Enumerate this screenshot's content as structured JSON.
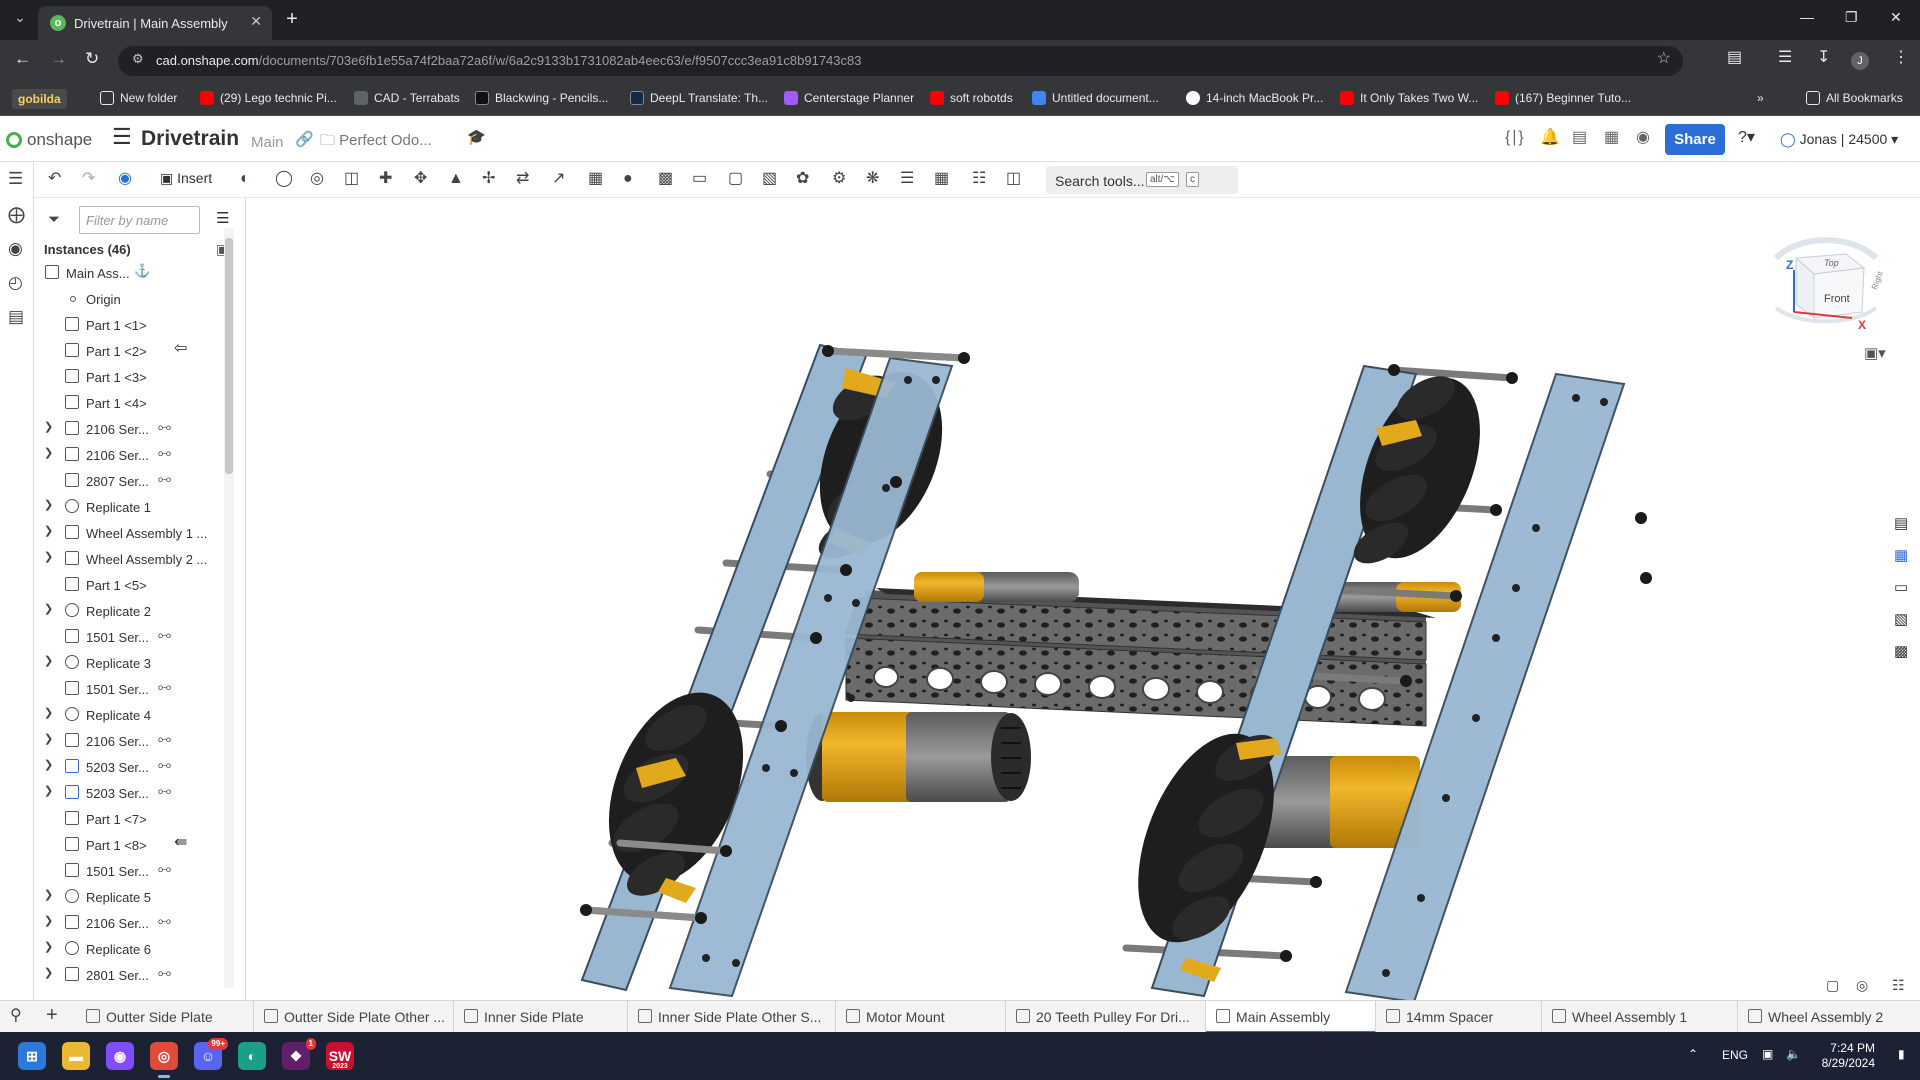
{
  "browser": {
    "tab_title": "Drivetrain | Main Assembly",
    "url_domain": "cad.onshape.com",
    "url_path": "/documents/703e6fb1e55a74f2baa72a6f/w/6a2c9133b1731082ab4eec63/e/f9507ccc3ea91c8b91743c83",
    "profile_initial": "J",
    "bookmarks": [
      {
        "label": "gobilda",
        "color": "#4a4a4a"
      },
      {
        "label": "New folder",
        "color": "#e8eaed"
      },
      {
        "label": "(29) Lego technic Pi...",
        "color": "#ff0000"
      },
      {
        "label": "CAD - Terrabats",
        "color": "#35363a"
      },
      {
        "label": "Blackwing - Pencils...",
        "color": "#111111"
      },
      {
        "label": "DeepL Translate: Th...",
        "color": "#0f2b46"
      },
      {
        "label": "Centerstage Planner",
        "color": "#a259ff"
      },
      {
        "label": "soft robotds",
        "color": "#ff0000"
      },
      {
        "label": "Untitled document...",
        "color": "#4285f4"
      },
      {
        "label": "14-inch MacBook Pr...",
        "color": "#ffffff"
      },
      {
        "label": "It Only Takes Two W...",
        "color": "#ff0000"
      },
      {
        "label": "(167) Beginner Tuto...",
        "color": "#ff0000"
      }
    ],
    "all_bookmarks": "All Bookmarks"
  },
  "header": {
    "app_name": "onshape",
    "doc_name": "Drivetrain",
    "branch": "Main",
    "folder": "Perfect Odo...",
    "share_label": "Share",
    "user": "Jonas | 24500"
  },
  "toolbar": {
    "insert_label": "Insert",
    "search_label": "Search tools...",
    "shortcut_1": "alt/⌥",
    "shortcut_2": "c"
  },
  "panel": {
    "filter_placeholder": "Filter by name",
    "instances_header": "Instances (46)",
    "rows": [
      {
        "label": "Main Ass...",
        "chevron": false,
        "indent": 0,
        "kind": "assembly",
        "badge": "⚓",
        "arrow": ""
      },
      {
        "label": "Origin",
        "chevron": false,
        "indent": 1,
        "kind": "origin",
        "badge": "",
        "arrow": ""
      },
      {
        "label": "Part 1 <1>",
        "chevron": false,
        "indent": 1,
        "kind": "part",
        "badge": "",
        "arrow": ""
      },
      {
        "label": "Part 1 <2>",
        "chevron": false,
        "indent": 1,
        "kind": "part",
        "badge": "",
        "arrow": "⇦"
      },
      {
        "label": "Part 1 <3>",
        "chevron": false,
        "indent": 1,
        "kind": "part",
        "badge": "",
        "arrow": ""
      },
      {
        "label": "Part 1 <4>",
        "chevron": false,
        "indent": 1,
        "kind": "part",
        "badge": "",
        "arrow": ""
      },
      {
        "label": "2106 Ser...",
        "chevron": true,
        "indent": 1,
        "kind": "part",
        "badge": "⧟",
        "arrow": ""
      },
      {
        "label": "2106 Ser...",
        "chevron": true,
        "indent": 1,
        "kind": "part",
        "badge": "⧟",
        "arrow": ""
      },
      {
        "label": "2807 Ser...",
        "chevron": false,
        "indent": 1,
        "kind": "part",
        "badge": "⧟",
        "arrow": ""
      },
      {
        "label": "Replicate 1",
        "chevron": true,
        "indent": 1,
        "kind": "replicate",
        "badge": "",
        "arrow": ""
      },
      {
        "label": "Wheel Assembly 1 ...",
        "chevron": true,
        "indent": 1,
        "kind": "assembly",
        "badge": "",
        "arrow": ""
      },
      {
        "label": "Wheel Assembly 2 ...",
        "chevron": true,
        "indent": 1,
        "kind": "assembly",
        "badge": "",
        "arrow": ""
      },
      {
        "label": "Part 1 <5>",
        "chevron": false,
        "indent": 1,
        "kind": "part",
        "badge": "",
        "arrow": ""
      },
      {
        "label": "Replicate 2",
        "chevron": true,
        "indent": 1,
        "kind": "replicate",
        "badge": "",
        "arrow": ""
      },
      {
        "label": "1501 Ser...",
        "chevron": false,
        "indent": 1,
        "kind": "part",
        "badge": "⧟",
        "arrow": ""
      },
      {
        "label": "Replicate 3",
        "chevron": true,
        "indent": 1,
        "kind": "replicate",
        "badge": "",
        "arrow": ""
      },
      {
        "label": "1501 Ser...",
        "chevron": false,
        "indent": 1,
        "kind": "part",
        "badge": "⧟",
        "arrow": ""
      },
      {
        "label": "Replicate 4",
        "chevron": true,
        "indent": 1,
        "kind": "replicate",
        "badge": "",
        "arrow": ""
      },
      {
        "label": "2106 Ser...",
        "chevron": true,
        "indent": 1,
        "kind": "part",
        "badge": "⧟",
        "arrow": ""
      },
      {
        "label": "5203 Ser...",
        "chevron": true,
        "indent": 1,
        "kind": "assembly-blue",
        "badge": "⧟",
        "arrow": ""
      },
      {
        "label": "5203 Ser...",
        "chevron": true,
        "indent": 1,
        "kind": "assembly-blue",
        "badge": "⧟",
        "arrow": ""
      },
      {
        "label": "Part 1 <7>",
        "chevron": false,
        "indent": 1,
        "kind": "part",
        "badge": "",
        "arrow": ""
      },
      {
        "label": "Part 1 <8>",
        "chevron": false,
        "indent": 1,
        "kind": "part",
        "badge": "",
        "arrow": "⇚"
      },
      {
        "label": "1501 Ser...",
        "chevron": false,
        "indent": 1,
        "kind": "part",
        "badge": "⧟",
        "arrow": ""
      },
      {
        "label": "Replicate 5",
        "chevron": true,
        "indent": 1,
        "kind": "replicate",
        "badge": "",
        "arrow": ""
      },
      {
        "label": "2106 Ser...",
        "chevron": true,
        "indent": 1,
        "kind": "part",
        "badge": "⧟",
        "arrow": ""
      },
      {
        "label": "Replicate 6",
        "chevron": true,
        "indent": 1,
        "kind": "replicate",
        "badge": "",
        "arrow": ""
      },
      {
        "label": "2801 Ser...",
        "chevron": true,
        "indent": 1,
        "kind": "part",
        "badge": "⧟",
        "arrow": ""
      }
    ]
  },
  "viewcube": {
    "top": "Top",
    "front": "Front",
    "right": "Right",
    "axis_x": "X",
    "axis_z": "Z"
  },
  "tabs": [
    {
      "label": "Outter Side Plate",
      "active": false
    },
    {
      "label": "Outter Side Plate Other ...",
      "active": false
    },
    {
      "label": "Inner Side Plate",
      "active": false
    },
    {
      "label": "Inner Side Plate Other S...",
      "active": false
    },
    {
      "label": "Motor Mount",
      "active": false
    },
    {
      "label": "20 Teeth Pulley For Dri...",
      "active": false
    },
    {
      "label": "Main Assembly",
      "active": true
    },
    {
      "label": "14mm Spacer",
      "active": false
    },
    {
      "label": "Wheel Assembly 1",
      "active": false
    },
    {
      "label": "Wheel Assembly 2",
      "active": false
    }
  ],
  "taskbar": {
    "apps": [
      {
        "name": "start",
        "color": "#2b79d8"
      },
      {
        "name": "file-explorer",
        "color": "#e8b931"
      },
      {
        "name": "messenger",
        "color": "#7f4dff"
      },
      {
        "name": "chrome",
        "color": "#dd4b39"
      },
      {
        "name": "discord",
        "color": "#5865f2",
        "badge": "99+"
      },
      {
        "name": "app-blue-green",
        "color": "#1aa086"
      },
      {
        "name": "slack",
        "color": "#611f69",
        "badge": "1"
      },
      {
        "name": "solidworks",
        "color": "#c8102e",
        "label": "2023"
      }
    ],
    "language": "ENG",
    "time": "7:24 PM",
    "date": "8/29/2024"
  },
  "colors": {
    "share": "#2c6dd6",
    "plate": "#9ab7d2",
    "motor": "#e3a91c",
    "brand": "#4bae4f"
  }
}
